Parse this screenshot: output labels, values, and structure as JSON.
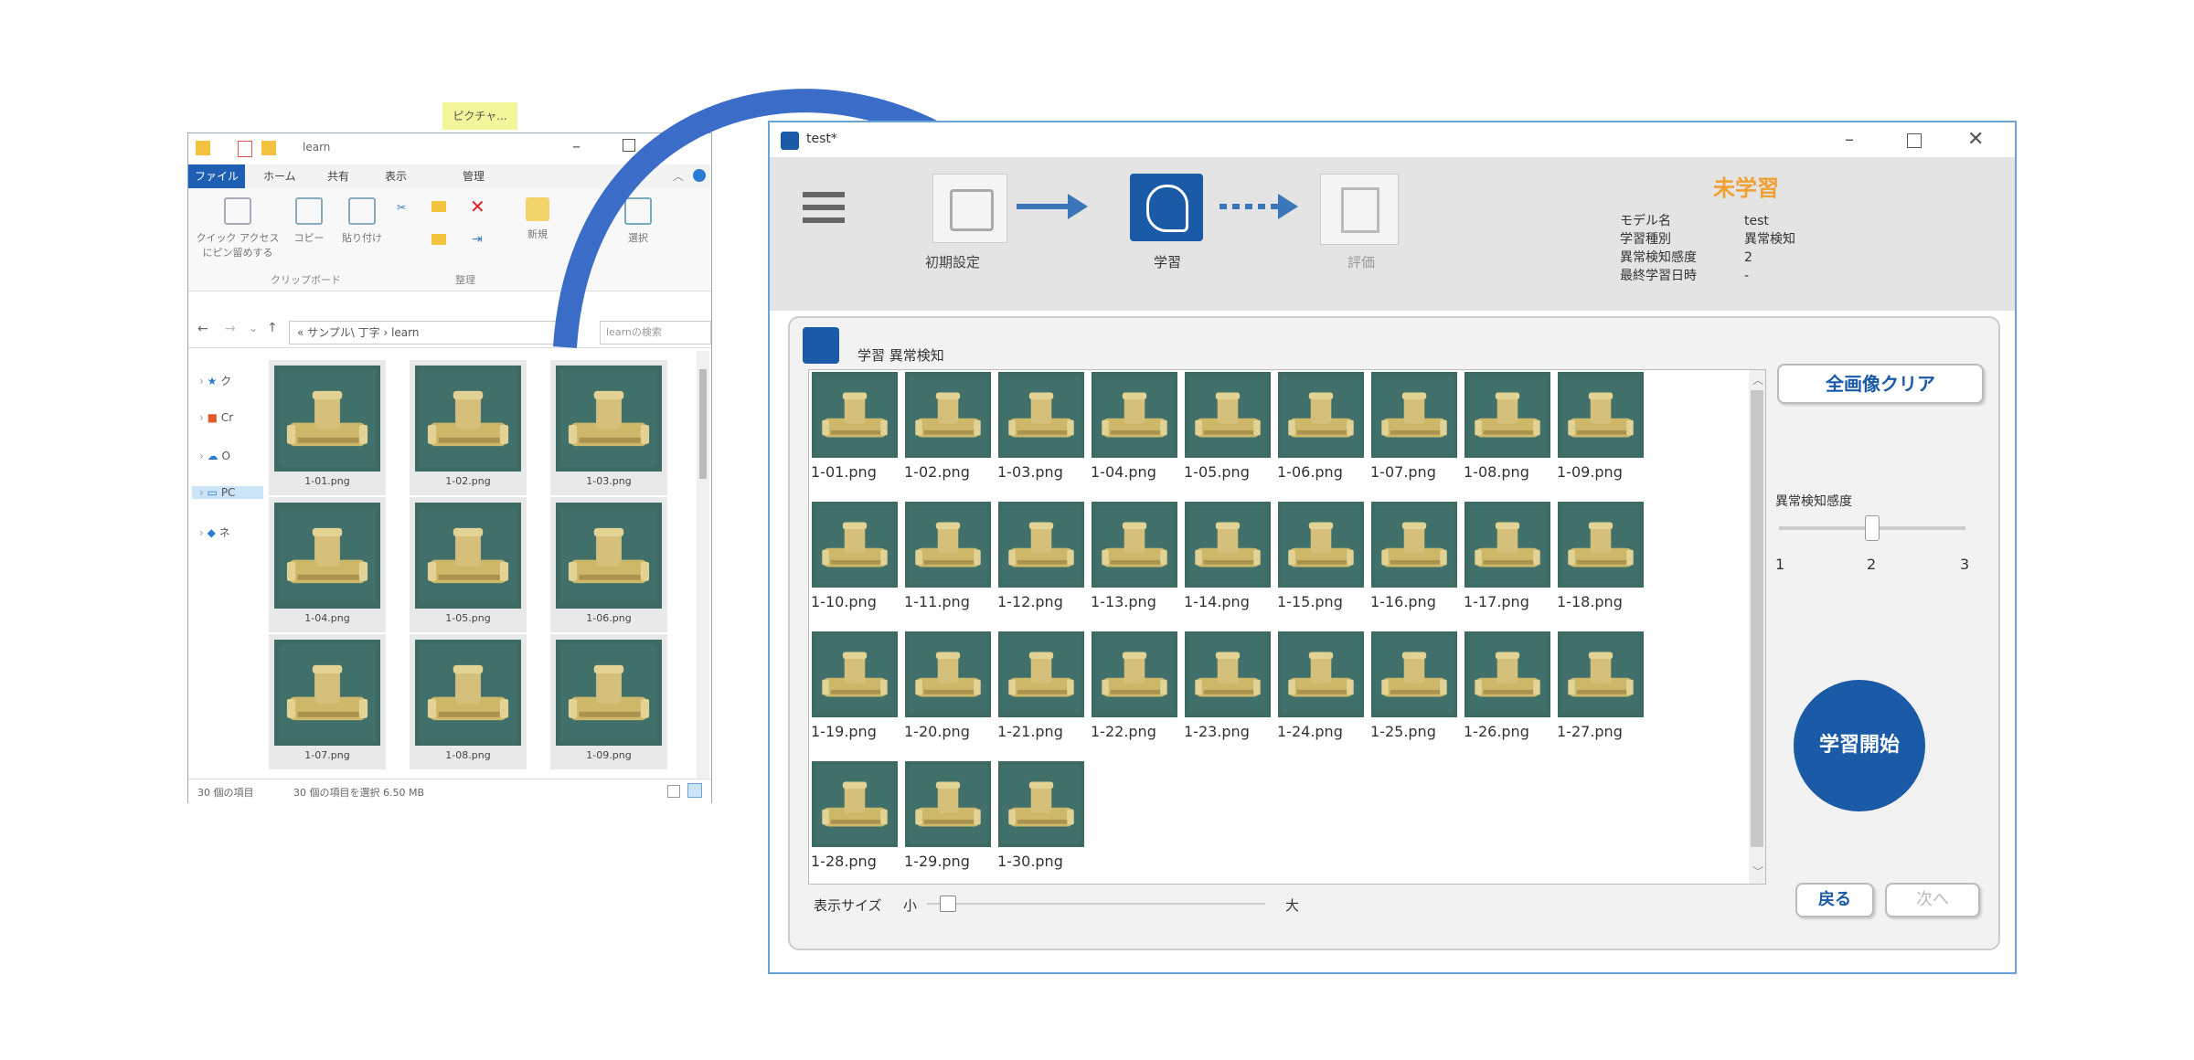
{
  "explorer": {
    "title": "learn",
    "context_tab": "ピクチャ...",
    "ribbon_tabs": [
      "ファイル",
      "ホーム",
      "共有",
      "表示",
      "管理"
    ],
    "ribbon_buttons": [
      "クイック アクセス にピン留めする",
      "コピー",
      "貼り付け",
      "新規",
      "選択"
    ],
    "group_labels": [
      "クリップボード",
      "整理"
    ],
    "address": "« サンプル\\ 丁字 › learn",
    "search_placeholder": "learnの検索",
    "nav_items": [
      "ク",
      "Cr",
      "O",
      "PC",
      "ネ"
    ],
    "files": [
      "1-01.png",
      "1-02.png",
      "1-03.png",
      "1-04.png",
      "1-05.png",
      "1-06.png",
      "1-07.png",
      "1-08.png",
      "1-09.png"
    ],
    "status_items": "30 個の項目",
    "status_selected": "30 個の項目を選択 6.50 MB"
  },
  "app": {
    "title": "test*",
    "steps": [
      {
        "label": "初期設定",
        "state": "done"
      },
      {
        "label": "学習",
        "state": "active"
      },
      {
        "label": "評価",
        "state": "disabled"
      }
    ],
    "status_heading": "未学習",
    "info": [
      {
        "key": "モデル名",
        "value": "test"
      },
      {
        "key": "学習種別",
        "value": "異常検知"
      },
      {
        "key": "異常検知感度",
        "value": "2"
      },
      {
        "key": "最終学習日時",
        "value": "-"
      }
    ],
    "panel_title": "学習 異常検知",
    "clear_button": "全画像クリア",
    "sensitivity_label": "異常検知感度",
    "sensitivity_ticks": [
      "1",
      "2",
      "3"
    ],
    "sensitivity_value": 2,
    "start_button": "学習開始",
    "size_label": "表示サイズ",
    "size_small": "小",
    "size_large": "大",
    "back_button": "戻る",
    "next_button": "次へ",
    "images": [
      "1-01.png",
      "1-02.png",
      "1-03.png",
      "1-04.png",
      "1-05.png",
      "1-06.png",
      "1-07.png",
      "1-08.png",
      "1-09.png",
      "1-10.png",
      "1-11.png",
      "1-12.png",
      "1-13.png",
      "1-14.png",
      "1-15.png",
      "1-16.png",
      "1-17.png",
      "1-18.png",
      "1-19.png",
      "1-20.png",
      "1-21.png",
      "1-22.png",
      "1-23.png",
      "1-24.png",
      "1-25.png",
      "1-26.png",
      "1-27.png",
      "1-28.png",
      "1-29.png",
      "1-30.png"
    ]
  },
  "colors": {
    "accent": "#1b5aa6",
    "status": "#f0a030",
    "thumb_bg": "#3d6a62",
    "part": "#cdb86a"
  }
}
